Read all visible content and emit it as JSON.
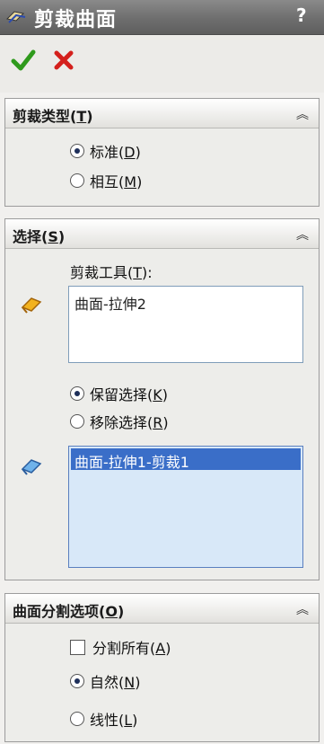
{
  "window": {
    "title": "剪裁曲面",
    "help": "?"
  },
  "actions": {
    "ok_icon": "green-check-icon",
    "cancel_icon": "red-x-icon"
  },
  "trim_type": {
    "title": "剪裁类型(",
    "title_key": "T",
    "title_end": ")",
    "options": [
      {
        "label": "标准(",
        "key": "D",
        "end": ")",
        "selected": true
      },
      {
        "label": "相互(",
        "key": "M",
        "end": ")",
        "selected": false
      }
    ]
  },
  "selection": {
    "title": "选择(",
    "title_key": "S",
    "title_end": ")",
    "tool_label": "剪裁工具(",
    "tool_key": "T",
    "tool_end": "):",
    "tool_value": "曲面-拉伸2",
    "keep_remove": [
      {
        "label": "保留选择(",
        "key": "K",
        "end": ")",
        "selected": true
      },
      {
        "label": "移除选择(",
        "key": "R",
        "end": ")",
        "selected": false
      }
    ],
    "pieces_value": "曲面-拉伸1-剪裁1"
  },
  "split": {
    "title": "曲面分割选项(",
    "title_key": "O",
    "title_end": ")",
    "split_all": {
      "label": "分割所有(",
      "key": "A",
      "end": ")",
      "checked": false
    },
    "options": [
      {
        "label": "自然(",
        "key": "N",
        "end": ")",
        "selected": true
      },
      {
        "label": "线性(",
        "key": "L",
        "end": ")",
        "selected": false
      }
    ]
  },
  "colors": {
    "title_bg": "#707070",
    "selected_item": "#3a6ec8",
    "list_bg": "#d8e8f8"
  }
}
